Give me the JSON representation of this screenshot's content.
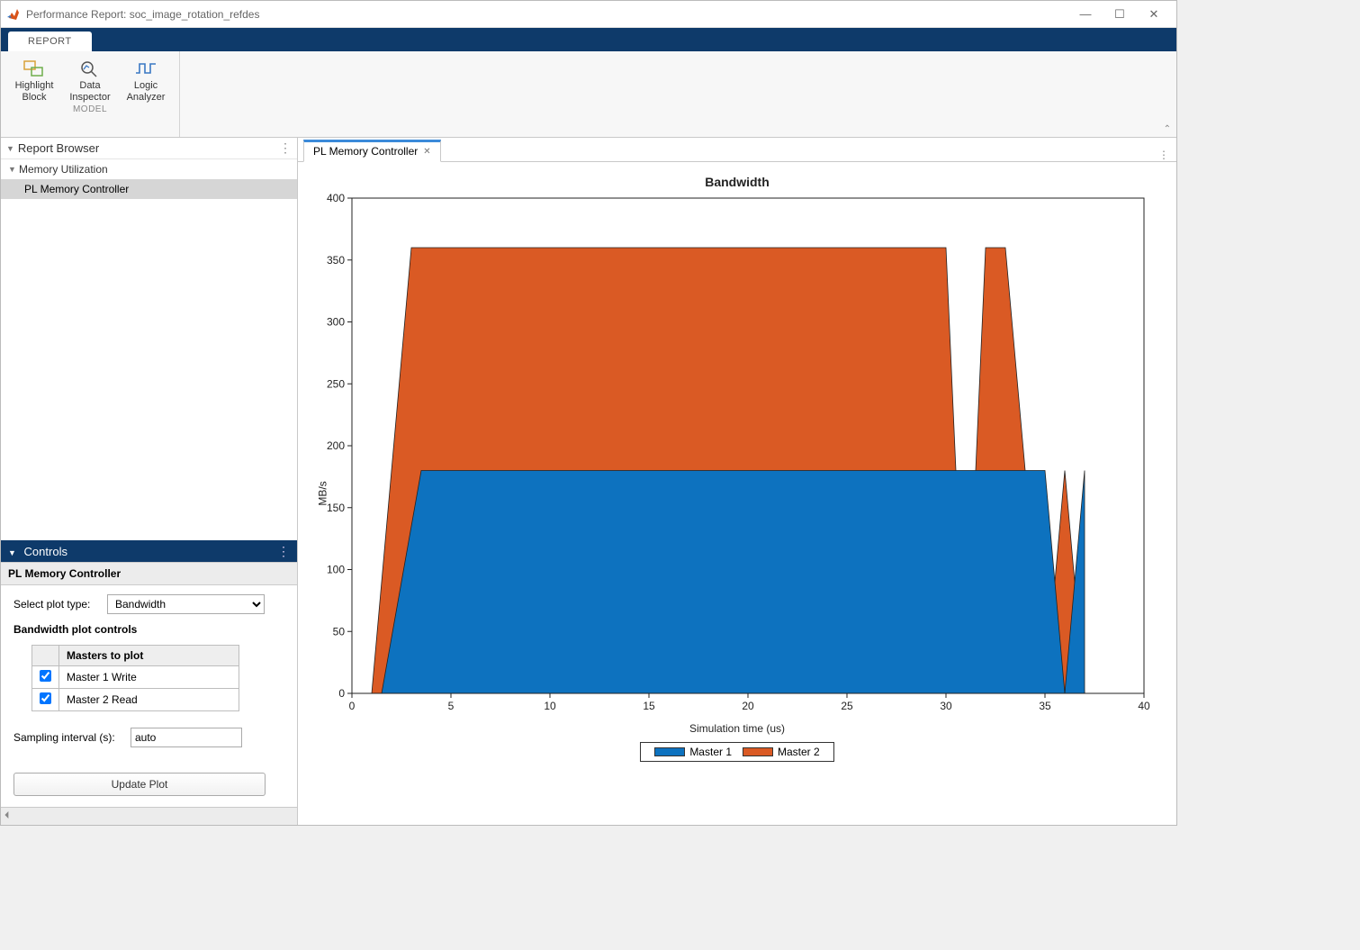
{
  "window": {
    "title": "Performance Report: soc_image_rotation_refdes"
  },
  "ribbon": {
    "tab": "REPORT",
    "items": {
      "highlight": {
        "line1": "Highlight",
        "line2": "Block"
      },
      "dataInspector": {
        "line1": "Data",
        "line2": "Inspector"
      },
      "logicAnalyzer": {
        "line1": "Logic",
        "line2": "Analyzer"
      }
    },
    "group_label": "MODEL"
  },
  "browser": {
    "title": "Report Browser",
    "root": "Memory Utilization",
    "child": "PL Memory Controller"
  },
  "controls": {
    "title": "Controls",
    "subtitle": "PL Memory Controller",
    "plot_type_label": "Select plot type:",
    "plot_type_value": "Bandwidth",
    "section_label": "Bandwidth plot controls",
    "masters_header": "Masters to plot",
    "masters": [
      {
        "label": "Master 1 Write",
        "checked": true
      },
      {
        "label": "Master 2 Read",
        "checked": true
      }
    ],
    "sampling_label": "Sampling interval (s):",
    "sampling_value": "auto",
    "update_btn": "Update Plot"
  },
  "doc_tab": "PL Memory Controller",
  "chart_data": {
    "type": "area",
    "title": "Bandwidth",
    "xlabel": "Simulation time (us)",
    "ylabel": "MB/s",
    "xlim": [
      0,
      40
    ],
    "ylim": [
      0,
      400
    ],
    "xticks": [
      0,
      5,
      10,
      15,
      20,
      25,
      30,
      35,
      40
    ],
    "yticks": [
      0,
      50,
      100,
      150,
      200,
      250,
      300,
      350,
      400
    ],
    "legend": [
      "Master 1",
      "Master 2"
    ],
    "colors": {
      "Master 1": "#0d72bf",
      "Master 2": "#da5a24"
    },
    "series": [
      {
        "name": "Master 2",
        "x": [
          1,
          3,
          30,
          31,
          32,
          33,
          35,
          36,
          37
        ],
        "y": [
          0,
          360,
          360,
          0,
          360,
          360,
          0,
          180,
          0
        ]
      },
      {
        "name": "Master 1",
        "x": [
          1.5,
          3.5,
          35,
          36,
          37
        ],
        "y": [
          0,
          180,
          180,
          0,
          180
        ]
      }
    ]
  }
}
